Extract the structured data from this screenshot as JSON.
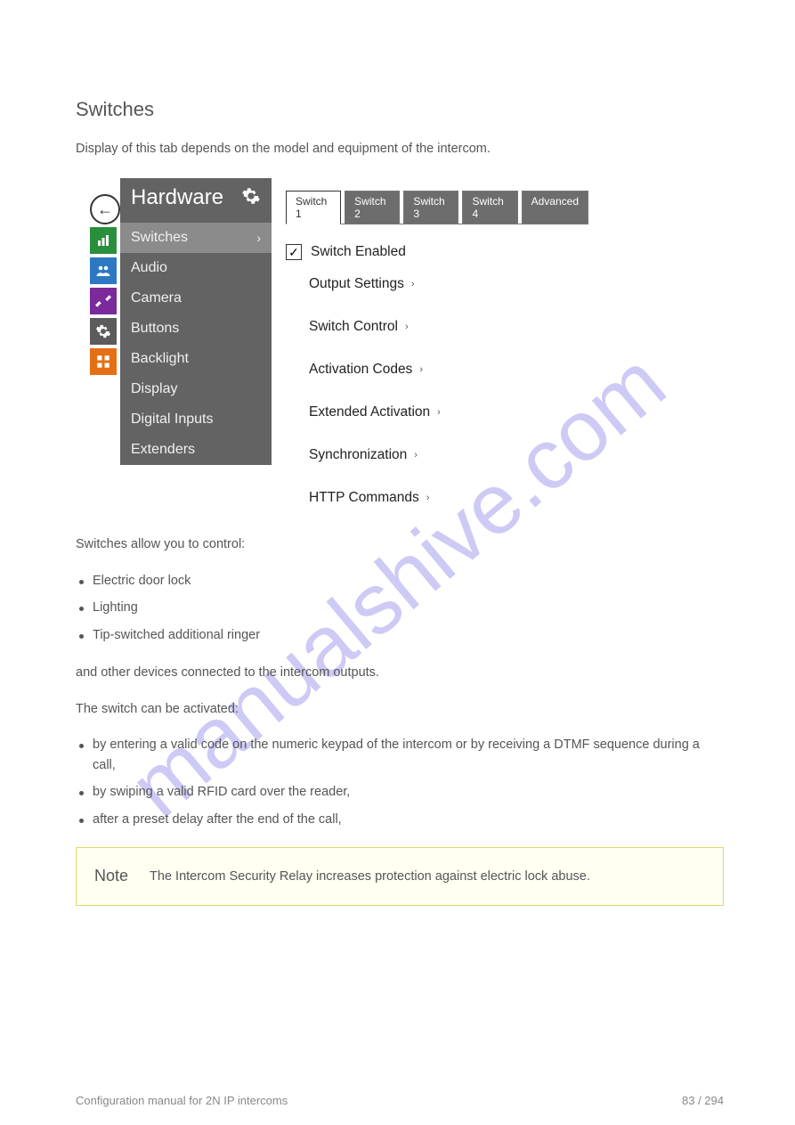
{
  "watermark": "manualshive.com",
  "heading": "Switches",
  "intro_text": "Display of this tab depends on the model and equipment of the intercom.",
  "screenshot": {
    "sidebar": {
      "title": "Hardware",
      "items": [
        {
          "label": "Switches",
          "active": true
        },
        {
          "label": "Audio"
        },
        {
          "label": "Camera"
        },
        {
          "label": "Buttons"
        },
        {
          "label": "Backlight"
        },
        {
          "label": "Display"
        },
        {
          "label": "Digital Inputs"
        },
        {
          "label": "Extenders"
        }
      ]
    },
    "tabs": [
      {
        "label": "Switch 1",
        "active": true
      },
      {
        "label": "Switch 2"
      },
      {
        "label": "Switch 3"
      },
      {
        "label": "Switch 4"
      },
      {
        "label": "Advanced"
      }
    ],
    "checkbox": {
      "label": "Switch Enabled",
      "checked": true
    },
    "links": [
      "Output Settings",
      "Switch Control",
      "Activation Codes",
      "Extended Activation",
      "Synchronization",
      "HTTP Commands"
    ]
  },
  "post_text": "Switches allow you to control:",
  "bullets": [
    "Electric door lock",
    "Lighting",
    "Tip-switched additional ringer"
  ],
  "post_bullets": "and other devices connected to the intercom outputs.",
  "features": {
    "lead": "The switch can be activated:",
    "items": [
      {
        "text": "by entering a valid code on the numeric keypad of the intercom or by receiving a DTMF sequence during a call,"
      },
      {
        "text": "by swiping a valid RFID card over the reader,"
      },
      {
        "text": "after a preset delay after the end of the call,"
      }
    ]
  },
  "callout": {
    "head": "Note",
    "body": "The Intercom Security Relay increases protection against electric lock abuse."
  },
  "footer": {
    "left": "Configuration manual for 2N IP intercoms",
    "right": "83 / 294"
  }
}
